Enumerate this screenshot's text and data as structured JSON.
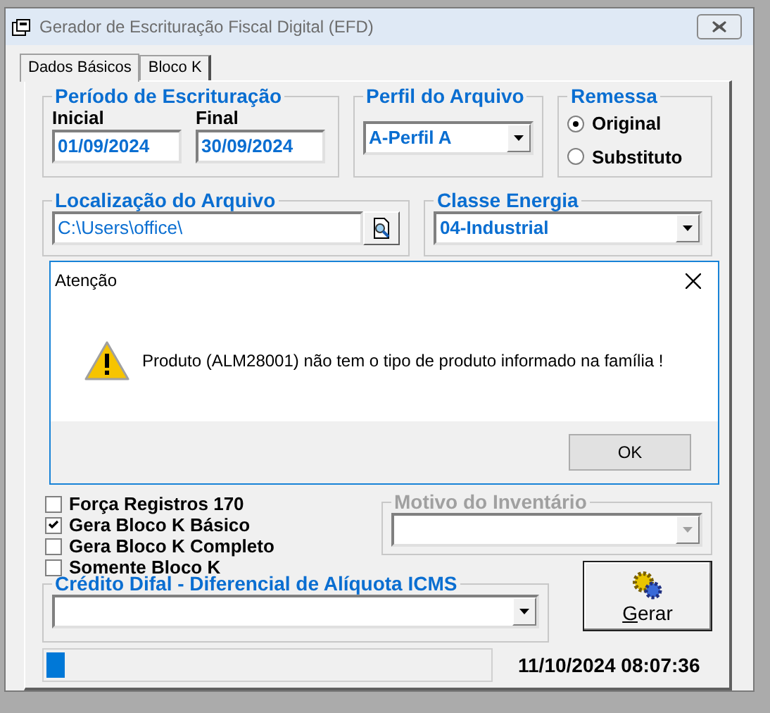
{
  "window": {
    "title": "Gerador de Escrituração Fiscal Digital (EFD)"
  },
  "tabs": [
    {
      "label": "Dados Básicos",
      "selected": true
    },
    {
      "label": "Bloco K",
      "selected": false
    }
  ],
  "periodo": {
    "title": "Período de Escrituração",
    "inicial_label": "Inicial",
    "inicial": "01/09/2024",
    "final_label": "Final",
    "final": "30/09/2024"
  },
  "perfil": {
    "title": "Perfil do Arquivo",
    "value": "A-Perfil A"
  },
  "remessa": {
    "title": "Remessa",
    "options": [
      {
        "label": "Original",
        "selected": true
      },
      {
        "label": "Substituto",
        "selected": false
      }
    ]
  },
  "localizacao": {
    "title": "Localização do Arquivo",
    "value": "C:\\Users\\office\\"
  },
  "classe": {
    "title": "Classe Energia",
    "value": "04-Industrial"
  },
  "options": [
    {
      "label": "Força Registros 170",
      "checked": false
    },
    {
      "label": "Gera Bloco K Básico",
      "checked": true
    },
    {
      "label": "Gera Bloco K Completo",
      "checked": false
    },
    {
      "label": "Somente Bloco K",
      "checked": false
    }
  ],
  "motivo": {
    "title": "Motivo do Inventário",
    "disabled": true
  },
  "credito": {
    "title": "Crédito Difal - Diferencial de Alíquota ICMS"
  },
  "gerar": {
    "label": "Gerar"
  },
  "progress": {
    "level": 0.04
  },
  "timestamp": "11/10/2024 08:07:36",
  "dialog": {
    "title": "Atenção",
    "message": "Produto (ALM28001) não tem o tipo de produto informado na família !",
    "button": "OK"
  }
}
